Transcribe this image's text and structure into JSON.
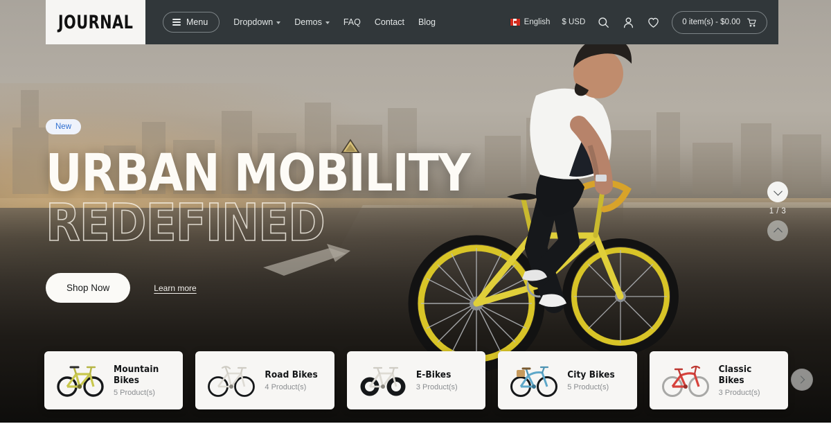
{
  "header": {
    "logo": "JOURNAL",
    "menu_button": "Menu",
    "nav_items": [
      {
        "label": "Dropdown",
        "has_caret": true
      },
      {
        "label": "Demos",
        "has_caret": true
      },
      {
        "label": "FAQ",
        "has_caret": false
      },
      {
        "label": "Contact",
        "has_caret": false
      },
      {
        "label": "Blog",
        "has_caret": false
      }
    ],
    "language": "English",
    "currency": "$ USD",
    "search_icon": "search-icon",
    "account_icon": "user-icon",
    "wishlist_icon": "heart-icon",
    "cart_label": "0 item(s) - $0.00",
    "cart_icon": "shopping-cart-icon",
    "bar_color": "#31373a",
    "logo_bg": "#f6f5f3"
  },
  "hero": {
    "badge": "New",
    "headline_solid": "URBAN MOBILITY",
    "headline_outline": "REDEFINED",
    "primary_button": "Shop Now",
    "secondary_link": "Learn more",
    "badge_bg": "#eef2fb",
    "badge_text_color": "#2f6fd0",
    "button_bg": "#fbfaf7"
  },
  "slider": {
    "counter": "1 / 3",
    "next_icon": "chevron-down-icon",
    "prev_icon": "chevron-up-icon",
    "next_enabled": true,
    "prev_enabled": false
  },
  "categories": {
    "next_icon": "chevron-right-icon",
    "items": [
      {
        "title": "Mountain Bikes",
        "count": "5  Product(s)",
        "thumb": "mountain-bike-thumbnail",
        "color": "#c9c84e"
      },
      {
        "title": "Road Bikes",
        "count": "4  Product(s)",
        "thumb": "road-bike-thumbnail",
        "color": "#e8e6e1"
      },
      {
        "title": "E-Bikes",
        "count": "3  Product(s)",
        "thumb": "e-bike-thumbnail",
        "color": "#dedbd4"
      },
      {
        "title": "City Bikes",
        "count": "5  Product(s)",
        "thumb": "city-bike-thumbnail",
        "color": "#5fa8c9"
      },
      {
        "title": "Classic Bikes",
        "count": "3  Product(s)",
        "thumb": "classic-bike-thumbnail",
        "color": "#d6423c"
      }
    ]
  }
}
